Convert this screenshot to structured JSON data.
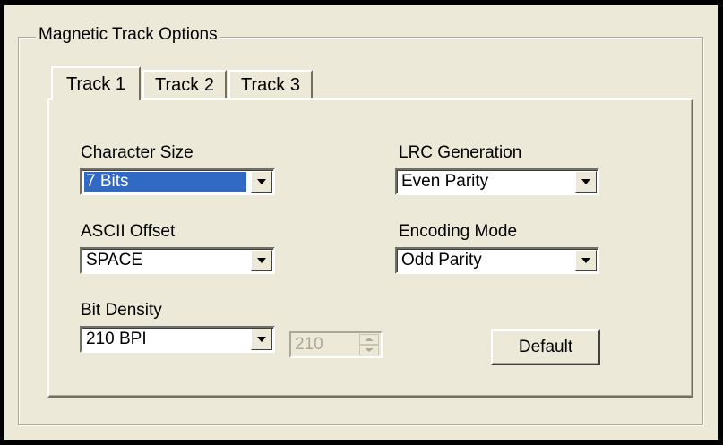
{
  "group": {
    "title": "Magnetic Track Options"
  },
  "tabs": [
    {
      "label": "Track 1",
      "active": true
    },
    {
      "label": "Track 2",
      "active": false
    },
    {
      "label": "Track 3",
      "active": false
    }
  ],
  "fields": {
    "character_size": {
      "label": "Character Size",
      "value": "7 Bits"
    },
    "ascii_offset": {
      "label": "ASCII Offset",
      "value": "SPACE"
    },
    "bit_density": {
      "label": "Bit Density",
      "value": "210 BPI"
    },
    "bit_density_spinner": {
      "value": "210",
      "enabled": false
    },
    "lrc_generation": {
      "label": "LRC Generation",
      "value": "Even Parity"
    },
    "encoding_mode": {
      "label": "Encoding Mode",
      "value": "Odd Parity"
    }
  },
  "buttons": {
    "default_label": "Default"
  },
  "icons": {
    "dropdown": "chevron-down-icon",
    "spin_up": "spin-up-icon",
    "spin_down": "spin-down-icon"
  },
  "colors": {
    "selection": "#316ac5",
    "face": "#ece9d8"
  }
}
